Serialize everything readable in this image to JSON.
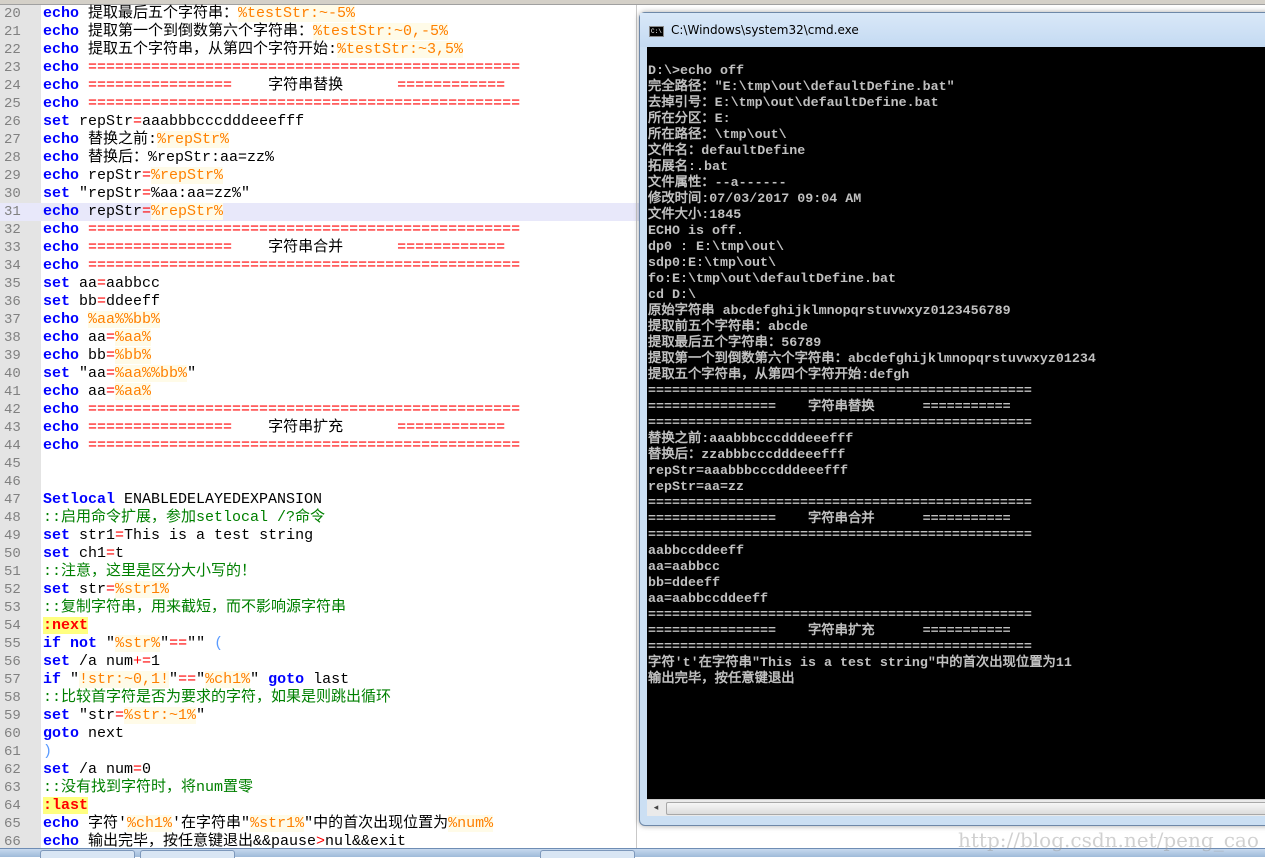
{
  "editor": {
    "current_line": 31,
    "lines": [
      {
        "n": "20",
        "segs": [
          [
            "k",
            "echo"
          ],
          [
            "t",
            " 提取最后五个字符串："
          ],
          [
            "v",
            "%testStr:~-5%"
          ]
        ]
      },
      {
        "n": "21",
        "segs": [
          [
            "k",
            "echo"
          ],
          [
            "t",
            " 提取第一个到倒数第六个字符串："
          ],
          [
            "v",
            "%testStr:~0,-5%"
          ]
        ]
      },
      {
        "n": "22",
        "segs": [
          [
            "k",
            "echo"
          ],
          [
            "t",
            " 提取五个字符串，从第四个字符开始:"
          ],
          [
            "v",
            "%testStr:~3,5%"
          ]
        ]
      },
      {
        "n": "23",
        "segs": [
          [
            "k",
            "echo"
          ],
          [
            "t",
            " "
          ],
          [
            "o",
            "================================================"
          ]
        ]
      },
      {
        "n": "24",
        "segs": [
          [
            "k",
            "echo"
          ],
          [
            "t",
            " "
          ],
          [
            "o",
            "================"
          ],
          [
            "t",
            "    字符串替换      "
          ],
          [
            "o",
            "============"
          ]
        ]
      },
      {
        "n": "25",
        "segs": [
          [
            "k",
            "echo"
          ],
          [
            "t",
            " "
          ],
          [
            "o",
            "================================================"
          ]
        ]
      },
      {
        "n": "26",
        "segs": [
          [
            "k",
            "set"
          ],
          [
            "t",
            " repStr"
          ],
          [
            "o",
            "="
          ],
          [
            "t",
            "aaabbbcccdddeeefff"
          ]
        ]
      },
      {
        "n": "27",
        "segs": [
          [
            "k",
            "echo"
          ],
          [
            "t",
            " 替换之前:"
          ],
          [
            "v",
            "%repStr%"
          ]
        ]
      },
      {
        "n": "28",
        "segs": [
          [
            "k",
            "echo"
          ],
          [
            "t",
            " 替换后：%repStr:aa=zz%"
          ]
        ]
      },
      {
        "n": "29",
        "segs": [
          [
            "k",
            "echo"
          ],
          [
            "t",
            " repStr"
          ],
          [
            "o",
            "="
          ],
          [
            "v",
            "%repStr%"
          ]
        ]
      },
      {
        "n": "30",
        "segs": [
          [
            "k",
            "set"
          ],
          [
            "t",
            " \"repStr"
          ],
          [
            "o",
            "="
          ],
          [
            "t",
            "%aa:aa=zz%\""
          ]
        ]
      },
      {
        "n": "31",
        "segs": [
          [
            "k",
            "echo"
          ],
          [
            "t",
            " repStr"
          ],
          [
            "o",
            "="
          ],
          [
            "v",
            "%repStr%"
          ]
        ]
      },
      {
        "n": "32",
        "segs": [
          [
            "k",
            "echo"
          ],
          [
            "t",
            " "
          ],
          [
            "o",
            "================================================"
          ]
        ]
      },
      {
        "n": "33",
        "segs": [
          [
            "k",
            "echo"
          ],
          [
            "t",
            " "
          ],
          [
            "o",
            "================"
          ],
          [
            "t",
            "    字符串合并      "
          ],
          [
            "o",
            "============"
          ]
        ]
      },
      {
        "n": "34",
        "segs": [
          [
            "k",
            "echo"
          ],
          [
            "t",
            " "
          ],
          [
            "o",
            "================================================"
          ]
        ]
      },
      {
        "n": "35",
        "segs": [
          [
            "k",
            "set"
          ],
          [
            "t",
            " aa"
          ],
          [
            "o",
            "="
          ],
          [
            "t",
            "aabbcc"
          ]
        ]
      },
      {
        "n": "36",
        "segs": [
          [
            "k",
            "set"
          ],
          [
            "t",
            " bb"
          ],
          [
            "o",
            "="
          ],
          [
            "t",
            "ddeeff"
          ]
        ]
      },
      {
        "n": "37",
        "segs": [
          [
            "k",
            "echo"
          ],
          [
            "t",
            " "
          ],
          [
            "v",
            "%aa%%bb%"
          ]
        ]
      },
      {
        "n": "38",
        "segs": [
          [
            "k",
            "echo"
          ],
          [
            "t",
            " aa"
          ],
          [
            "o",
            "="
          ],
          [
            "v",
            "%aa%"
          ]
        ]
      },
      {
        "n": "39",
        "segs": [
          [
            "k",
            "echo"
          ],
          [
            "t",
            " bb"
          ],
          [
            "o",
            "="
          ],
          [
            "v",
            "%bb%"
          ]
        ]
      },
      {
        "n": "40",
        "segs": [
          [
            "k",
            "set"
          ],
          [
            "t",
            " \"aa"
          ],
          [
            "o",
            "="
          ],
          [
            "v",
            "%aa%%bb%"
          ],
          [
            "t",
            "\""
          ]
        ]
      },
      {
        "n": "41",
        "segs": [
          [
            "k",
            "echo"
          ],
          [
            "t",
            " aa"
          ],
          [
            "o",
            "="
          ],
          [
            "v",
            "%aa%"
          ]
        ]
      },
      {
        "n": "42",
        "segs": [
          [
            "k",
            "echo"
          ],
          [
            "t",
            " "
          ],
          [
            "o",
            "================================================"
          ]
        ]
      },
      {
        "n": "43",
        "segs": [
          [
            "k",
            "echo"
          ],
          [
            "t",
            " "
          ],
          [
            "o",
            "================"
          ],
          [
            "t",
            "    字符串扩充      "
          ],
          [
            "o",
            "============"
          ]
        ]
      },
      {
        "n": "44",
        "segs": [
          [
            "k",
            "echo"
          ],
          [
            "t",
            " "
          ],
          [
            "o",
            "================================================"
          ]
        ]
      },
      {
        "n": "45",
        "segs": []
      },
      {
        "n": "46",
        "segs": []
      },
      {
        "n": "47",
        "segs": [
          [
            "k",
            "Setlocal"
          ],
          [
            "t",
            " ENABLEDELAYEDEXPANSION"
          ]
        ]
      },
      {
        "n": "48",
        "segs": [
          [
            "c",
            "::启用命令扩展，参加setlocal /?命令"
          ]
        ]
      },
      {
        "n": "49",
        "segs": [
          [
            "k",
            "set"
          ],
          [
            "t",
            " str1"
          ],
          [
            "o",
            "="
          ],
          [
            "t",
            "This is a test string"
          ]
        ]
      },
      {
        "n": "50",
        "segs": [
          [
            "k",
            "set"
          ],
          [
            "t",
            " ch1"
          ],
          [
            "o",
            "="
          ],
          [
            "t",
            "t"
          ]
        ]
      },
      {
        "n": "51",
        "segs": [
          [
            "c",
            "::注意，这里是区分大小写的！"
          ]
        ]
      },
      {
        "n": "52",
        "segs": [
          [
            "k",
            "set"
          ],
          [
            "t",
            " str"
          ],
          [
            "o",
            "="
          ],
          [
            "v",
            "%str1%"
          ]
        ]
      },
      {
        "n": "53",
        "segs": [
          [
            "c",
            "::复制字符串，用来截短，而不影响源字符串"
          ]
        ]
      },
      {
        "n": "54",
        "segs": [
          [
            "l",
            ":next"
          ]
        ]
      },
      {
        "n": "55",
        "segs": [
          [
            "k",
            "if"
          ],
          [
            "t",
            " "
          ],
          [
            "k",
            "not"
          ],
          [
            "t",
            " \""
          ],
          [
            "v",
            "%str%"
          ],
          [
            "t",
            "\""
          ],
          [
            "o",
            "=="
          ],
          [
            "t",
            "\"\" "
          ],
          [
            "b",
            "("
          ]
        ]
      },
      {
        "n": "56",
        "segs": [
          [
            "k",
            "set"
          ],
          [
            "t",
            " /a num"
          ],
          [
            "o",
            "+="
          ],
          [
            "t",
            "1"
          ]
        ]
      },
      {
        "n": "57",
        "segs": [
          [
            "k",
            "if"
          ],
          [
            "t",
            " \""
          ],
          [
            "v",
            "!str:~0,1!"
          ],
          [
            "t",
            "\""
          ],
          [
            "o",
            "=="
          ],
          [
            "t",
            "\""
          ],
          [
            "v",
            "%ch1%"
          ],
          [
            "t",
            "\" "
          ],
          [
            "k",
            "goto"
          ],
          [
            "t",
            " last"
          ]
        ]
      },
      {
        "n": "58",
        "segs": [
          [
            "c",
            "::比较首字符是否为要求的字符，如果是则跳出循环"
          ]
        ]
      },
      {
        "n": "59",
        "segs": [
          [
            "k",
            "set"
          ],
          [
            "t",
            " \"str"
          ],
          [
            "o",
            "="
          ],
          [
            "v",
            "%str:~1%"
          ],
          [
            "t",
            "\""
          ]
        ]
      },
      {
        "n": "60",
        "segs": [
          [
            "k",
            "goto"
          ],
          [
            "t",
            " next"
          ]
        ]
      },
      {
        "n": "61",
        "segs": [
          [
            "b",
            ")"
          ]
        ]
      },
      {
        "n": "62",
        "segs": [
          [
            "k",
            "set"
          ],
          [
            "t",
            " /a num"
          ],
          [
            "o",
            "="
          ],
          [
            "t",
            "0"
          ]
        ]
      },
      {
        "n": "63",
        "segs": [
          [
            "c",
            "::没有找到字符时，将num置零"
          ]
        ]
      },
      {
        "n": "64",
        "segs": [
          [
            "l",
            ":last"
          ]
        ]
      },
      {
        "n": "65",
        "segs": [
          [
            "k",
            "echo"
          ],
          [
            "t",
            " 字符'"
          ],
          [
            "v",
            "%ch1%"
          ],
          [
            "t",
            "'在字符串\""
          ],
          [
            "v",
            "%str1%"
          ],
          [
            "t",
            "\"中的首次出现位置为"
          ],
          [
            "v",
            "%num%"
          ]
        ]
      },
      {
        "n": "66",
        "segs": [
          [
            "k",
            "echo"
          ],
          [
            "t",
            " 输出完毕，按任意键退出&&pause"
          ],
          [
            "o",
            ">"
          ],
          [
            "t",
            "nul&&exit"
          ]
        ]
      }
    ]
  },
  "cmd": {
    "title": "C:\\Windows\\system32\\cmd.exe",
    "icon": "console-icon",
    "scroll_left": "◂",
    "lines": [
      "D:\\>echo off",
      "完全路径：\"E:\\tmp\\out\\defaultDefine.bat\"",
      "去掉引号：E:\\tmp\\out\\defaultDefine.bat",
      "所在分区：E:",
      "所在路径：\\tmp\\out\\",
      "文件名：defaultDefine",
      "拓展名:.bat",
      "文件属性：--a------",
      "修改时间:07/03/2017 09:04 AM",
      "文件大小:1845",
      "ECHO is off.",
      "dp0 : E:\\tmp\\out\\",
      "sdp0:E:\\tmp\\out\\",
      "fo:E:\\tmp\\out\\defaultDefine.bat",
      "cd D:\\",
      "原始字符串 abcdefghijklmnopqrstuvwxyz0123456789",
      "提取前五个字符串：abcde",
      "提取最后五个字符串：56789",
      "提取第一个到倒数第六个字符串：abcdefghijklmnopqrstuvwxyz01234",
      "提取五个字符串，从第四个字符开始:defgh",
      "================================================",
      "================    字符串替换      ===========",
      "================================================",
      "替换之前:aaabbbcccdddeeefff",
      "替换后：zzabbbcccdddeeefff",
      "repStr=aaabbbcccdddeeefff",
      "repStr=aa=zz",
      "================================================",
      "================    字符串合并      ===========",
      "================================================",
      "aabbccddeeff",
      "aa=aabbcc",
      "bb=ddeeff",
      "aa=aabbccddeeff",
      "================================================",
      "================    字符串扩充      ===========",
      "================================================",
      "字符't'在字符串\"This is a test string\"中的首次出现位置为11",
      "输出完毕，按任意键退出"
    ]
  },
  "watermark": "http://blog.csdn.net/peng_cao"
}
